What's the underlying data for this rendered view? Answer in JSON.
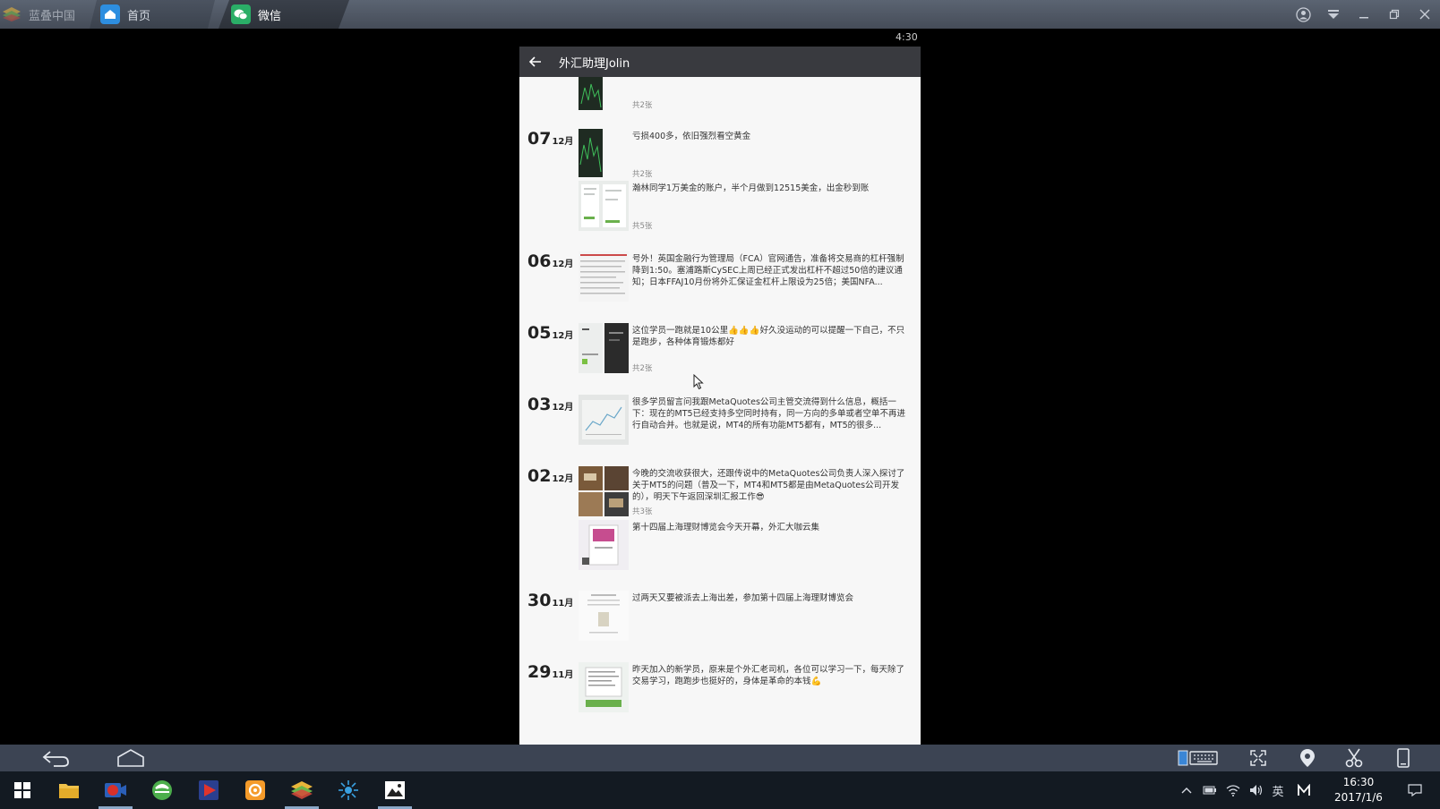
{
  "top_tabs": {
    "bluestacks": "蓝叠中国",
    "home": "首页",
    "wechat": "微信"
  },
  "status_bar": {
    "time": "4:30"
  },
  "app_bar": {
    "back_icon": "arrow-left",
    "title": "外汇助理Jolin"
  },
  "feed": {
    "top_count": "共2张",
    "entries": [
      {
        "day": "07",
        "month": "12月",
        "posts": [
          {
            "text": "亏损400多，依旧强烈看空黄金",
            "count": "共2张"
          },
          {
            "text": "瀚林同学1万美金的账户，半个月做到12515美金，出金秒到账",
            "count": "共5张"
          }
        ]
      },
      {
        "day": "06",
        "month": "12月",
        "posts": [
          {
            "text": "号外！英国金融行为管理局（FCA）官网通告，准备将交易商的杠杆强制降到1:50。塞浦路斯CySEC上周已经正式发出杠杆不超过50倍的建议通知；日本FFAJ10月份将外汇保证金杠杆上限设为25倍；美国NFA...",
            "count": ""
          }
        ]
      },
      {
        "day": "05",
        "month": "12月",
        "posts": [
          {
            "text": "这位学员一跑就是10公里👍👍👍好久没运动的可以提醒一下自己，不只是跑步，各种体育锻炼都好",
            "count": "共2张"
          }
        ]
      },
      {
        "day": "03",
        "month": "12月",
        "posts": [
          {
            "text": "很多学员留言问我跟MetaQuotes公司主管交流得到什么信息，概括一下：现在的MT5已经支持多空同时持有，同一方向的多单或者空单不再进行自动合并。也就是说，MT4的所有功能MT5都有，MT5的很多...",
            "count": ""
          }
        ]
      },
      {
        "day": "02",
        "month": "12月",
        "posts": [
          {
            "text": "今晚的交流收获很大，还跟传说中的MetaQuotes公司负责人深入探讨了关于MT5的问题（普及一下，MT4和MT5都是由MetaQuotes公司开发的），明天下午返回深圳汇报工作😎",
            "count": "共3张"
          },
          {
            "text": "第十四届上海理财博览会今天开幕，外汇大咖云集",
            "count": ""
          }
        ]
      },
      {
        "day": "30",
        "month": "11月",
        "posts": [
          {
            "text": "过两天又要被派去上海出差，参加第十四届上海理财博览会",
            "count": ""
          }
        ]
      },
      {
        "day": "29",
        "month": "11月",
        "posts": [
          {
            "text": "昨天加入的新学员，原来是个外汇老司机，各位可以学习一下，每天除了交易学习，跑跑步也挺好的，身体是革命的本钱💪",
            "count": ""
          }
        ]
      }
    ]
  },
  "android_nav": {
    "back_icon": "back-arrow",
    "home_icon": "home-outline"
  },
  "taskbar": {
    "clock_time": "16:30",
    "clock_date": "2017/1/6",
    "ime_label": "英"
  },
  "colors": {
    "app_bar": "#393a3f",
    "feed_bg": "#f7f7f7",
    "taskbar": "#131a22",
    "navbar": "#3c4453"
  }
}
